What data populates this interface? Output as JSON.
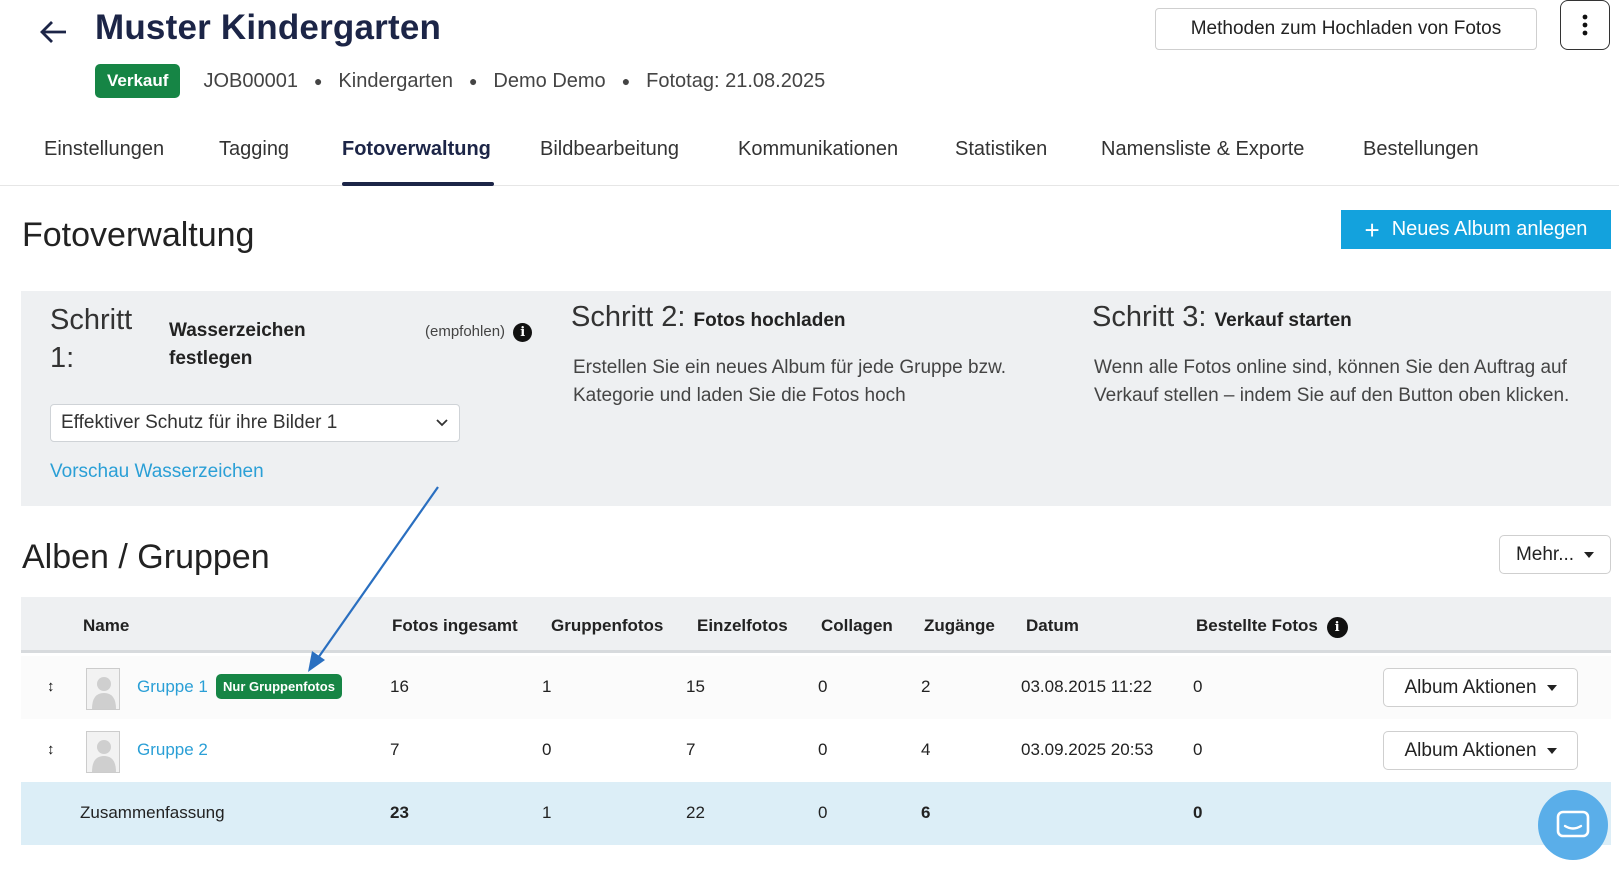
{
  "header": {
    "title": "Muster Kindergarten",
    "status_badge": "Verkauf",
    "job_id": "JOB00001",
    "category": "Kindergarten",
    "customer": "Demo Demo",
    "photo_day": "Fototag: 21.08.2025",
    "upload_methods_label": "Methoden zum Hochladen von Fotos",
    "icons": {
      "back": "arrow-left-icon",
      "more": "more-vertical-icon"
    }
  },
  "tabs": [
    {
      "label": "Einstellungen",
      "active": false
    },
    {
      "label": "Tagging",
      "active": false
    },
    {
      "label": "Fotoverwaltung",
      "active": true
    },
    {
      "label": "Bildbearbeitung",
      "active": false
    },
    {
      "label": "Kommunikationen",
      "active": false
    },
    {
      "label": "Statistiken",
      "active": false
    },
    {
      "label": "Namensliste & Exporte",
      "active": false
    },
    {
      "label": "Bestellungen",
      "active": false
    }
  ],
  "page": {
    "title": "Fotoverwaltung",
    "new_album_label": "Neues Album anlegen"
  },
  "steps": {
    "step1": {
      "head": "Schritt 1:",
      "title": "Wasserzeichen festlegen",
      "recommended": "(empfohlen)",
      "select_value": "Effektiver Schutz für ihre Bilder 1",
      "preview_link": "Vorschau Wasserzeichen"
    },
    "step2": {
      "head": "Schritt 2:",
      "title": "Fotos hochladen",
      "text": "Erstellen Sie ein neues Album für jede Gruppe bzw. Kategorie und laden Sie die Fotos hoch"
    },
    "step3": {
      "head": "Schritt 3:",
      "title": "Verkauf starten",
      "text": "Wenn alle Fotos online sind, können Sie den Auftrag auf Verkauf stellen – indem Sie auf den Button oben klicken."
    }
  },
  "albums": {
    "title": "Alben / Gruppen",
    "more_label": "Mehr...",
    "columns": [
      "Name",
      "Fotos ingesamt",
      "Gruppenfotos",
      "Einzelfotos",
      "Collagen",
      "Zugänge",
      "Datum",
      "Bestellte Fotos"
    ],
    "rows": [
      {
        "name": "Gruppe 1",
        "badge": "Nur Gruppenfotos",
        "total": "16",
        "group": "1",
        "single": "15",
        "collages": "0",
        "accesses": "2",
        "date": "03.08.2015 11:22",
        "ordered": "0",
        "actions_label": "Album Aktionen"
      },
      {
        "name": "Gruppe 2",
        "badge": "",
        "total": "7",
        "group": "0",
        "single": "7",
        "collages": "0",
        "accesses": "4",
        "date": "03.09.2025 20:53",
        "ordered": "0",
        "actions_label": "Album Aktionen"
      }
    ],
    "summary": {
      "label": "Zusammenfassung",
      "total": "23",
      "group": "1",
      "single": "22",
      "collages": "0",
      "accesses": "6",
      "ordered": "0"
    }
  },
  "colors": {
    "brand_dark": "#1c2547",
    "status_green": "#168545",
    "primary_blue": "#13a2dd",
    "link_blue": "#2a9fd6",
    "annotation_arrow": "#2a6fc0",
    "chat_bubble": "#5aaee9"
  }
}
